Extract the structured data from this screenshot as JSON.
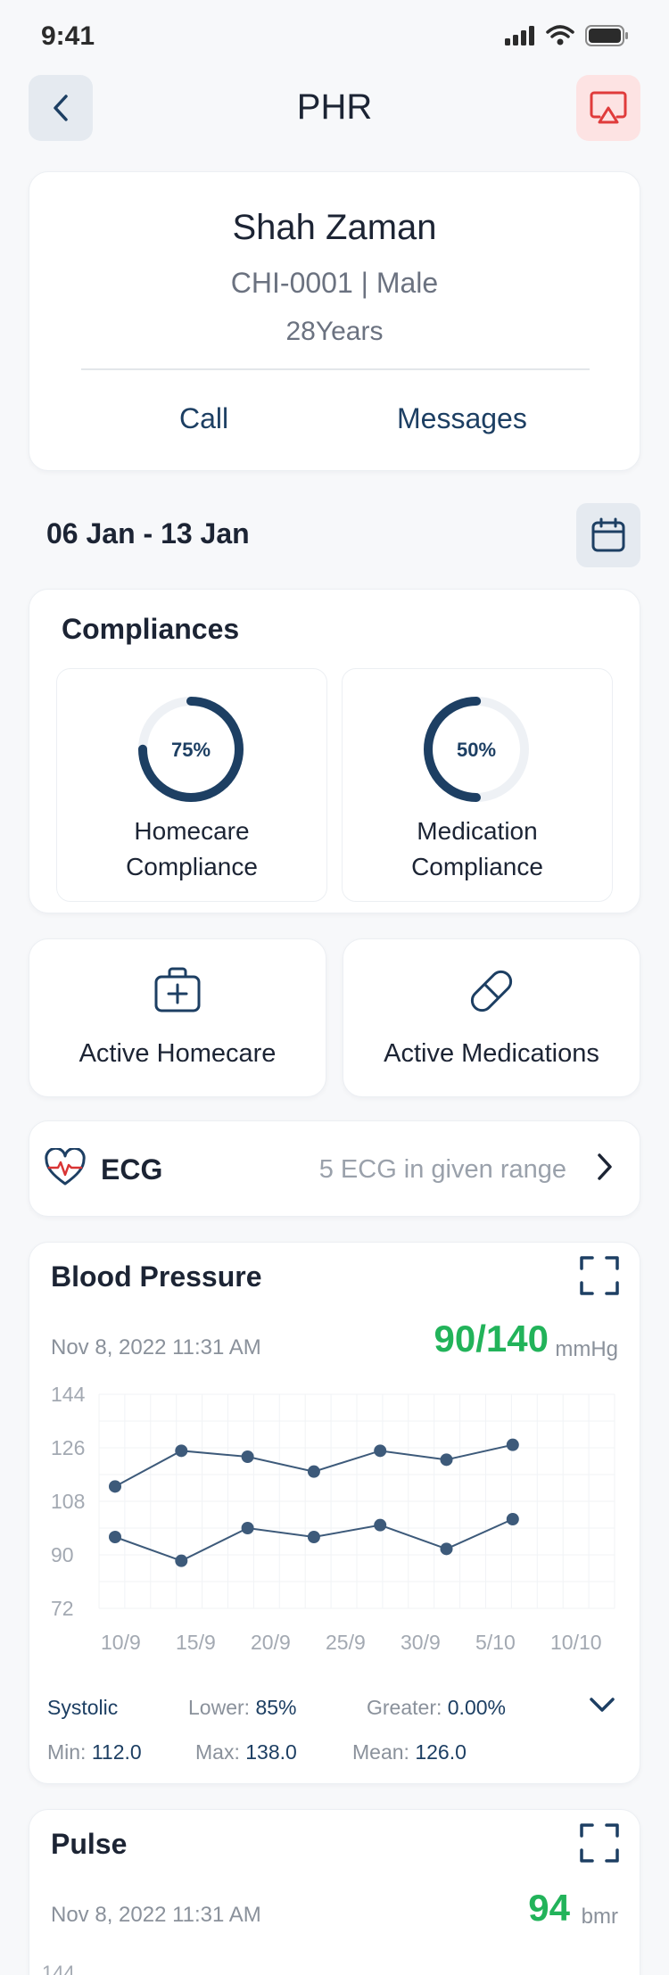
{
  "status_bar": {
    "time": "9:41"
  },
  "nav": {
    "title": "PHR"
  },
  "profile": {
    "name": "Shah Zaman",
    "id_gender": "CHI-0001 | Male",
    "age": "28Years",
    "call_label": "Call",
    "messages_label": "Messages"
  },
  "date_range": {
    "label": "06 Jan - 13 Jan"
  },
  "compliances": {
    "title": "Compliances",
    "items": [
      {
        "percent_text": "75%",
        "value": 0.75,
        "label_line1": "Homecare",
        "label_line2": "Compliance"
      },
      {
        "percent_text": "50%",
        "value": 0.5,
        "label_line1": "Medication",
        "label_line2": "Compliance"
      }
    ]
  },
  "actions": {
    "homecare_label": "Active Homecare",
    "medications_label": "Active Medications"
  },
  "ecg": {
    "title": "ECG",
    "detail": "5 ECG in given range"
  },
  "blood_pressure": {
    "title": "Blood Pressure",
    "date": "Nov 8, 2022 11:31 AM",
    "value": "90/140",
    "unit": "mmHg",
    "stats": {
      "series": "Systolic",
      "lower_label": "Lower:",
      "lower_value": "85%",
      "greater_label": "Greater:",
      "greater_value": "0.00%",
      "min_label": "Min:",
      "min_value": "112.0",
      "max_label": "Max:",
      "max_value": "138.0",
      "mean_label": "Mean:",
      "mean_value": "126.0"
    }
  },
  "pulse": {
    "title": "Pulse",
    "date": "Nov 8, 2022 11:31 AM",
    "value": "94",
    "unit": "bmr",
    "first_tick": "144"
  },
  "colors": {
    "accent": "#1d3f63",
    "value_green": "#22b35a",
    "cast_bg": "#fde3e3",
    "cast_icon": "#e03b3b",
    "ecg_red": "#d93434"
  },
  "chart_data": {
    "type": "line",
    "x": [
      "10/9",
      "15/9",
      "20/9",
      "25/9",
      "30/9",
      "5/10",
      "10/10"
    ],
    "ylim": [
      72,
      144
    ],
    "yticks": [
      "144",
      "126",
      "108",
      "90",
      "72"
    ],
    "grid": true,
    "series": [
      {
        "values": [
          113,
          125,
          123,
          118,
          125,
          122,
          127
        ]
      },
      {
        "values": [
          96,
          88,
          99,
          96,
          100,
          92,
          102
        ]
      }
    ]
  }
}
